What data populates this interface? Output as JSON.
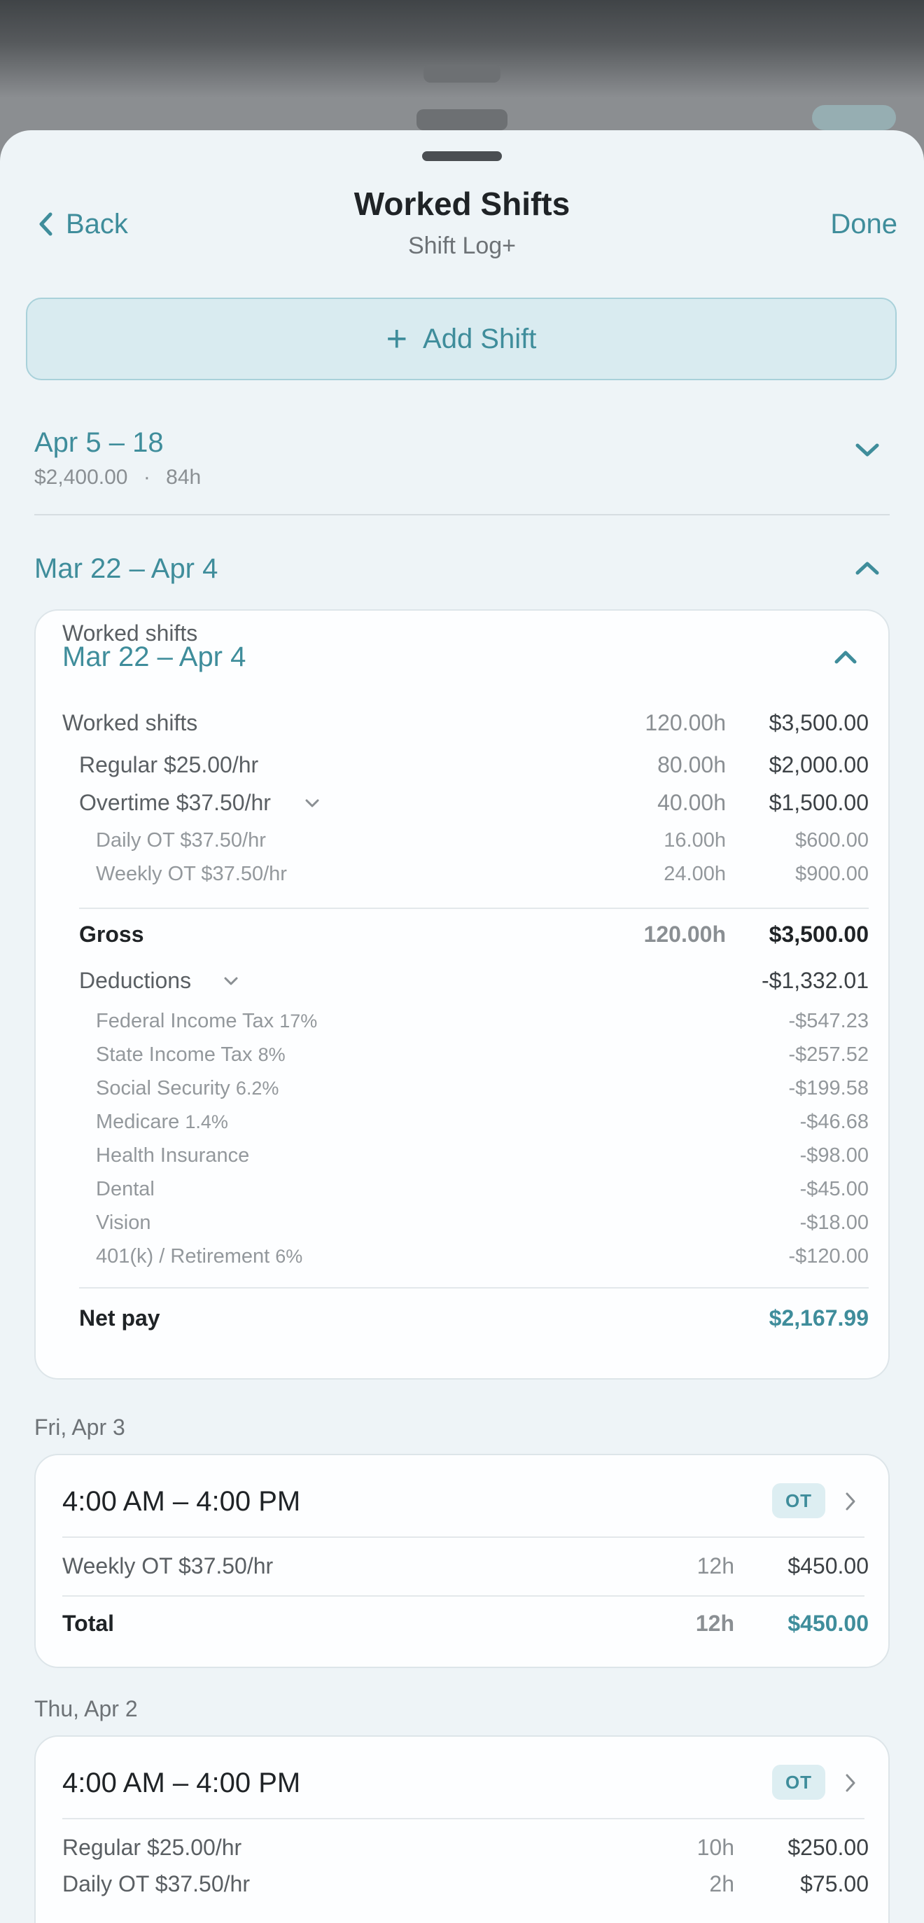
{
  "header": {
    "back_label": "Back",
    "title": "Worked Shifts",
    "subtitle": "Shift Log+",
    "done_label": "Done"
  },
  "add_shift": {
    "label": "Add Shift"
  },
  "periods": [
    {
      "title": "Apr 5 – 18",
      "amount": "$2,400.00",
      "separator": "·",
      "hours": "84h"
    },
    {
      "title": "Mar 22 – Apr 4"
    }
  ],
  "summary": {
    "title": "Mar 22 – Apr 4",
    "worked": {
      "label": "Worked shifts",
      "hours": "120.00h",
      "amount": "$3,500.00"
    },
    "regular": {
      "label": "Regular $25.00/hr",
      "hours": "80.00h",
      "amount": "$2,000.00"
    },
    "overtime": {
      "label": "Overtime $37.50/hr",
      "hours": "40.00h",
      "amount": "$1,500.00"
    },
    "daily_ot": {
      "label": "Daily OT $37.50/hr",
      "hours": "16.00h",
      "amount": "$600.00"
    },
    "weekly_ot": {
      "label": "Weekly OT $37.50/hr",
      "hours": "24.00h",
      "amount": "$900.00"
    },
    "gross": {
      "label": "Gross",
      "hours": "120.00h",
      "amount": "$3,500.00"
    },
    "deductions": {
      "label": "Deductions",
      "amount": "-$1,332.01",
      "items": [
        {
          "label": "Federal Income Tax",
          "pct": "17%",
          "amount": "-$547.23"
        },
        {
          "label": "State Income Tax",
          "pct": "8%",
          "amount": "-$257.52"
        },
        {
          "label": "Social Security",
          "pct": "6.2%",
          "amount": "-$199.58"
        },
        {
          "label": "Medicare",
          "pct": "1.4%",
          "amount": "-$46.68"
        },
        {
          "label": "Health Insurance",
          "pct": "",
          "amount": "-$98.00"
        },
        {
          "label": "Dental",
          "pct": "",
          "amount": "-$45.00"
        },
        {
          "label": "Vision",
          "pct": "",
          "amount": "-$18.00"
        },
        {
          "label": "401(k) / Retirement",
          "pct": "6%",
          "amount": "-$120.00"
        }
      ]
    },
    "net": {
      "label": "Net pay",
      "amount": "$2,167.99"
    }
  },
  "days": [
    {
      "date": "Fri, Apr 3",
      "time": "4:00 AM – 4:00 PM",
      "badge": "OT",
      "line": {
        "label": "Weekly OT $37.50/hr",
        "hours": "12h",
        "amount": "$450.00"
      },
      "total": {
        "label": "Total",
        "hours": "12h",
        "amount": "$450.00"
      }
    },
    {
      "date": "Thu, Apr 2",
      "time": "4:00 AM – 4:00 PM",
      "badge": "OT",
      "lines": [
        {
          "label": "Regular $25.00/hr",
          "hours": "10h",
          "amount": "$250.00"
        },
        {
          "label": "Daily OT $37.50/hr",
          "hours": "2h",
          "amount": "$75.00"
        }
      ]
    }
  ],
  "colors": {
    "accent": "#3f8d9b",
    "text": "#1f2326",
    "muted": "#6d7276",
    "sheet": "#eef4f7"
  }
}
